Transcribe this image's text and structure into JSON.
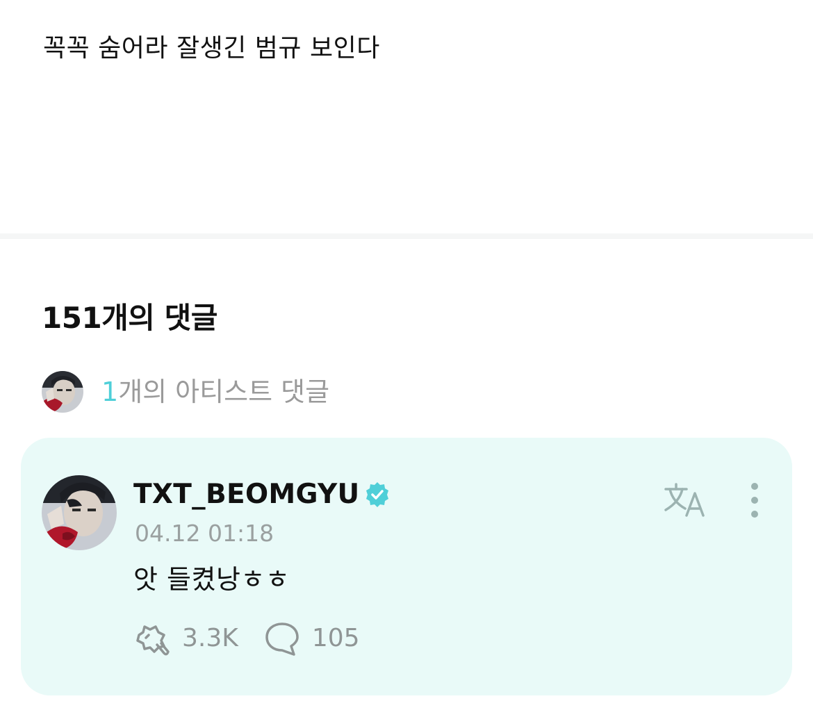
{
  "post": {
    "text": "꼭꼭 숨어라 잘생긴 범규 보인다"
  },
  "comments": {
    "title": "151개의 댓글",
    "artist_summary": {
      "count": "1",
      "label": "개의 아티스트 댓글"
    }
  },
  "comment": {
    "author": "TXT_BEOMGYU",
    "verified_icon": "verified-badge-icon",
    "timestamp": "04.12 01:18",
    "text": "앗 들켰낭ㅎㅎ",
    "likes": "3.3K",
    "replies": "105"
  },
  "icons": {
    "translate": "translate-icon",
    "more": "more-vertical-icon",
    "like": "like-icon",
    "reply": "comment-bubble-icon"
  },
  "colors": {
    "accent": "#4fcfd8",
    "card_background": "#e9faf8",
    "muted_text": "#9a9a9a"
  }
}
